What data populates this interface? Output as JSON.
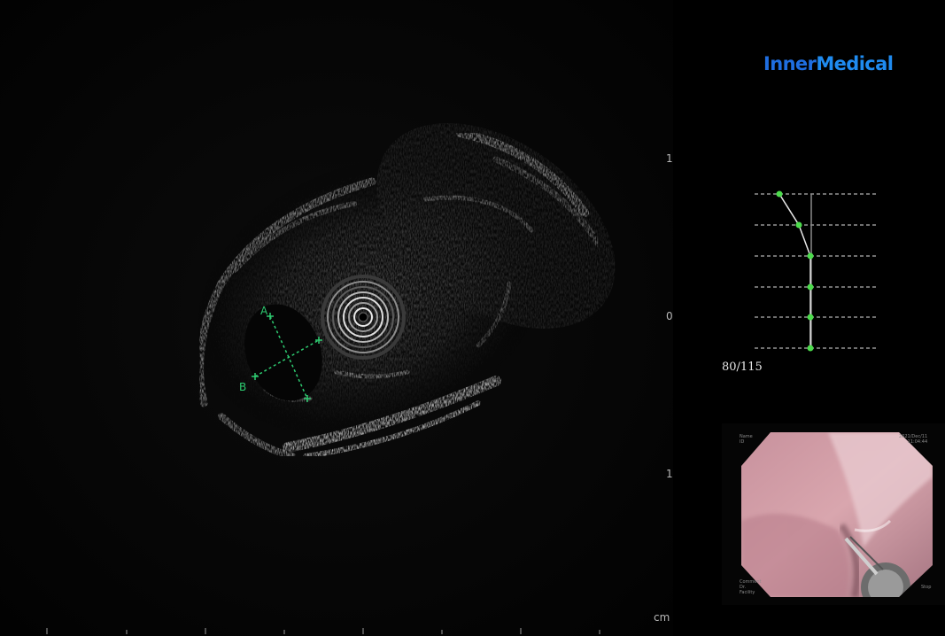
{
  "brand": {
    "logo_text_1": "Inner",
    "logo_text_2": "Medical",
    "color_1": "#1f6ee0",
    "color_2": "#1f8bf0"
  },
  "depth_scale": {
    "label_top": "1",
    "label_middle": "0",
    "label_bottom": "1",
    "unit": "cm"
  },
  "measurement": {
    "marker_a": "A",
    "marker_b": "B",
    "color": "#2ecc71"
  },
  "scan_position": {
    "counter": "80/115",
    "track_color": "#4cdc4c"
  },
  "endoscope_view": {
    "top_left": "Name\nID",
    "top_right": "2021/Dec/11\n11:04:44",
    "bottom_left": "Comment\nDr.\nFacility",
    "bottom_right": "Stop"
  }
}
